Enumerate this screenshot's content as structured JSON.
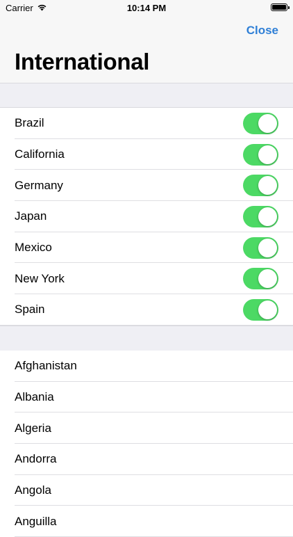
{
  "status_bar": {
    "carrier": "Carrier",
    "time": "10:14 PM"
  },
  "nav": {
    "close_label": "Close",
    "title": "International"
  },
  "toggles": [
    {
      "label": "Brazil",
      "on": true
    },
    {
      "label": "California",
      "on": true
    },
    {
      "label": "Germany",
      "on": true
    },
    {
      "label": "Japan",
      "on": true
    },
    {
      "label": "Mexico",
      "on": true
    },
    {
      "label": "New York",
      "on": true
    },
    {
      "label": "Spain",
      "on": true
    }
  ],
  "countries": [
    "Afghanistan",
    "Albania",
    "Algeria",
    "Andorra",
    "Angola",
    "Anguilla"
  ],
  "colors": {
    "accent": "#2f7fd6",
    "switch_on": "#4cd964",
    "grouped_background": "#efeff4"
  }
}
